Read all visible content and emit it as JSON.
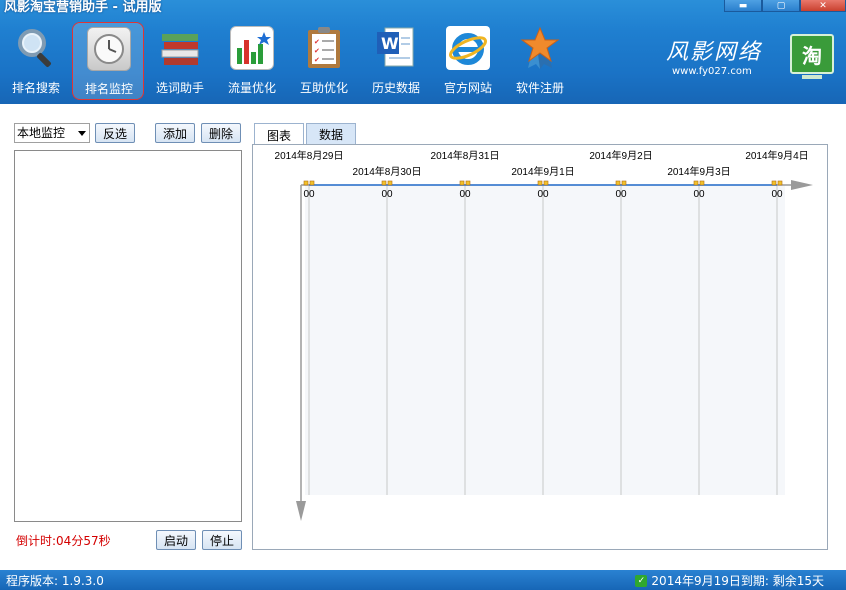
{
  "window": {
    "title": "风影淘宝营销助手 - 试用版",
    "buttons": {
      "minimize": "▬",
      "maximize": "▢",
      "close": "✕"
    }
  },
  "toolbar": {
    "items": [
      {
        "label": "排名搜索",
        "icon": "magnifier-icon"
      },
      {
        "label": "排名监控",
        "icon": "clock-icon",
        "active": true
      },
      {
        "label": "选词助手",
        "icon": "books-icon"
      },
      {
        "label": "流量优化",
        "icon": "bar-chart-icon"
      },
      {
        "label": "互助优化",
        "icon": "clipboard-checklist-icon"
      },
      {
        "label": "历史数据",
        "icon": "word-document-icon"
      },
      {
        "label": "官方网站",
        "icon": "ie-browser-icon"
      },
      {
        "label": "软件注册",
        "icon": "star-medal-icon"
      }
    ]
  },
  "brand": {
    "name": "风影网络",
    "url": "www.fy027.com",
    "taobao_glyph": "淘"
  },
  "left": {
    "select_value": "本地监控",
    "invert_label": "反选",
    "add_label": "添加",
    "delete_label": "删除",
    "countdown": "倒计时:04分57秒",
    "start_label": "启动",
    "stop_label": "停止"
  },
  "tabs": [
    {
      "label": "图表",
      "selected": true
    },
    {
      "label": "数据",
      "selected": false
    }
  ],
  "chart_data": {
    "type": "line",
    "x": [
      "2014年8月29日",
      "2014年8月30日",
      "2014年8月31日",
      "2014年9月1日",
      "2014年9月2日",
      "2014年9月3日",
      "2014年9月4日"
    ],
    "series": [
      {
        "values": [
          0,
          0,
          0,
          0,
          0,
          0,
          0
        ]
      }
    ],
    "point_labels": [
      "00",
      "00",
      "00",
      "00",
      "00",
      "00",
      "00"
    ],
    "line_color": "#2f78d8",
    "grid": true
  },
  "status": {
    "version": "程序版本: 1.9.3.0",
    "expiry": "2014年9月19日到期: 剩余15天"
  }
}
